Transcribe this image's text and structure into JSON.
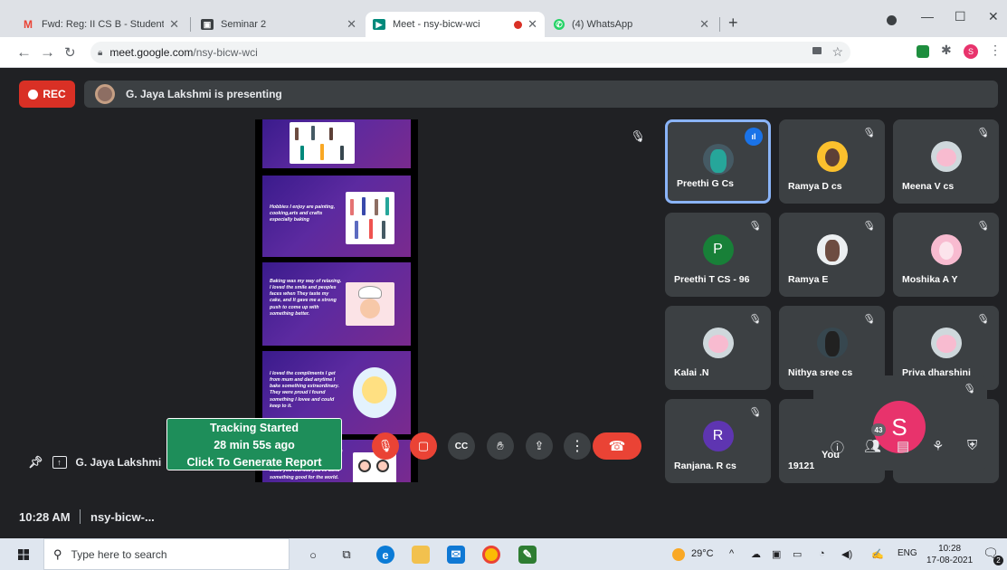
{
  "tabs": [
    {
      "title": "Fwd: Reg: II CS B - Students Deta",
      "icon": "gmail-icon",
      "color": "#ea4335"
    },
    {
      "title": "Seminar 2",
      "icon": "slides-icon",
      "color": "#3c4043"
    },
    {
      "title": "Meet - nsy-bicw-wci",
      "icon": "meet-icon",
      "color": "#00897b"
    },
    {
      "title": "(4) WhatsApp",
      "icon": "whatsapp-icon",
      "color": "#25d366"
    }
  ],
  "address": {
    "host": "meet.google.com",
    "path": "/nsy-bicw-wci"
  },
  "meet": {
    "rec_label": "REC",
    "presenting_text": "G. Jaya Lakshmi is presenting",
    "presenter_name": "G. Jaya Lakshmi",
    "slides": [
      {
        "text": ""
      },
      {
        "text": "Hobbies I enjoy are painting, cooking,arts and crafts especially baking"
      },
      {
        "text": "Baking was my way of relaxing. I loved the smile and peoples faces when They taste my cake, and It gave me a strong push to come up with something better."
      },
      {
        "text": "I loved the compliments I get from mum and dad anytime I bake something extraordinary. They were proud I found something I lovee and could keep to it."
      },
      {
        "text": "Banking for others can increase a feeling of wellbeing. Contribute to stress relief and make you feel like you've done something good for the world."
      }
    ],
    "participants": [
      {
        "name": "Preethi G Cs",
        "avatar": "photo",
        "speaking": true,
        "muted": false
      },
      {
        "name": "Ramya D cs",
        "avatar": "photo",
        "muted": true
      },
      {
        "name": "Meena V cs",
        "avatar": "photo",
        "muted": true
      },
      {
        "name": "Preethi T CS - 96",
        "avatar": "P",
        "avatar_color": "#188038",
        "muted": true
      },
      {
        "name": "Ramya E",
        "avatar": "photo",
        "muted": true
      },
      {
        "name": "Moshika A Y",
        "avatar": "photo",
        "muted": true
      },
      {
        "name": "Kalai .N",
        "avatar": "photo",
        "muted": true
      },
      {
        "name": "Nithya sree cs",
        "avatar": "photo",
        "muted": true
      },
      {
        "name": "Priya dharshini",
        "avatar": "photo",
        "muted": true
      },
      {
        "name": "Ranjana. R cs",
        "avatar": "R",
        "avatar_color": "#5e35b1",
        "muted": true
      },
      {
        "name": "19121",
        "avatar": "",
        "muted": true
      }
    ],
    "self": {
      "label": "You",
      "initial": "S"
    },
    "clock": "10:28 AM",
    "meeting_code": "nsy-bicw-...",
    "tracking": {
      "line1": "Tracking Started",
      "line2": "28 min 55s ago",
      "line3": "Click To Generate Report"
    },
    "participant_count": "43"
  },
  "taskbar": {
    "search_placeholder": "Type here to search",
    "weather": "29°C",
    "lang": "ENG",
    "time": "10:28",
    "date": "17-08-2021",
    "notif_count": "2"
  }
}
